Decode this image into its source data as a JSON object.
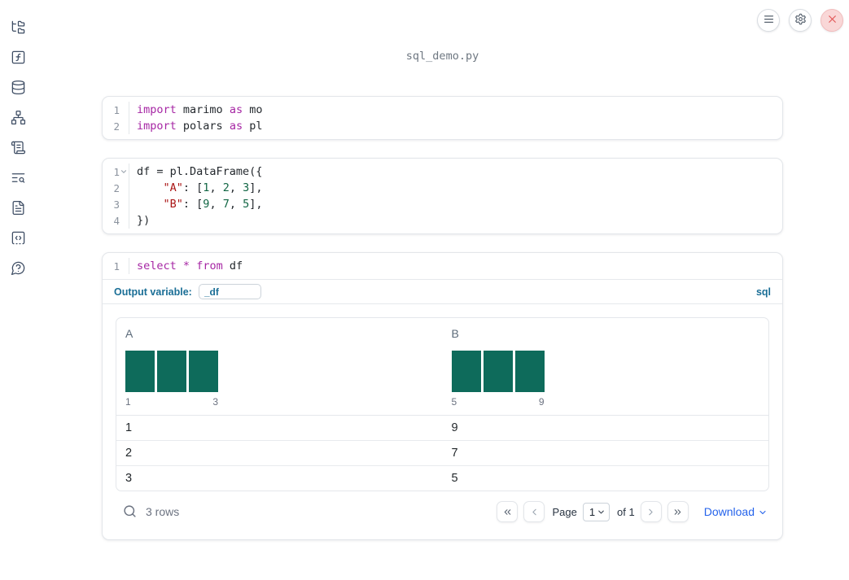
{
  "page": {
    "title": "sql_demo.py"
  },
  "sidebar": {
    "items": [
      {
        "name": "file-explorer",
        "icon": "folder-tree-icon"
      },
      {
        "name": "variables",
        "icon": "function-square-icon"
      },
      {
        "name": "data-sources",
        "icon": "database-icon"
      },
      {
        "name": "dependencies",
        "icon": "network-icon"
      },
      {
        "name": "logs",
        "icon": "scroll-text-icon"
      },
      {
        "name": "outline-search",
        "icon": "text-search-icon"
      },
      {
        "name": "documentation",
        "icon": "file-text-icon"
      },
      {
        "name": "scratchpad",
        "icon": "code-scratchpad-icon"
      },
      {
        "name": "help",
        "icon": "help-bubble-icon"
      }
    ]
  },
  "controls": [
    {
      "name": "menu",
      "icon": "menu-icon"
    },
    {
      "name": "settings",
      "icon": "gear-icon"
    },
    {
      "name": "close",
      "icon": "close-icon"
    }
  ],
  "cells": [
    {
      "type": "python",
      "line_start": 1,
      "lines": [
        [
          {
            "k": "kw",
            "t": "import"
          },
          {
            "k": "pl",
            "t": " marimo "
          },
          {
            "k": "kw",
            "t": "as"
          },
          {
            "k": "pl",
            "t": " mo"
          }
        ],
        [
          {
            "k": "kw",
            "t": "import"
          },
          {
            "k": "pl",
            "t": " polars "
          },
          {
            "k": "kw",
            "t": "as"
          },
          {
            "k": "pl",
            "t": " pl"
          }
        ]
      ]
    },
    {
      "type": "python",
      "line_start": 1,
      "fold_line": 1,
      "lines": [
        [
          {
            "k": "pl",
            "t": "df = pl.DataFrame({"
          }
        ],
        [
          {
            "k": "pl",
            "t": "    "
          },
          {
            "k": "str",
            "t": "\"A\""
          },
          {
            "k": "pl",
            "t": ": ["
          },
          {
            "k": "num",
            "t": "1"
          },
          {
            "k": "pl",
            "t": ", "
          },
          {
            "k": "num",
            "t": "2"
          },
          {
            "k": "pl",
            "t": ", "
          },
          {
            "k": "num",
            "t": "3"
          },
          {
            "k": "pl",
            "t": "],"
          }
        ],
        [
          {
            "k": "pl",
            "t": "    "
          },
          {
            "k": "str",
            "t": "\"B\""
          },
          {
            "k": "pl",
            "t": ": ["
          },
          {
            "k": "num",
            "t": "9"
          },
          {
            "k": "pl",
            "t": ", "
          },
          {
            "k": "num",
            "t": "7"
          },
          {
            "k": "pl",
            "t": ", "
          },
          {
            "k": "num",
            "t": "5"
          },
          {
            "k": "pl",
            "t": "],"
          }
        ],
        [
          {
            "k": "pl",
            "t": "})"
          }
        ]
      ]
    },
    {
      "type": "sql",
      "line_start": 1,
      "lines": [
        [
          {
            "k": "kw",
            "t": "select"
          },
          {
            "k": "pl",
            "t": " "
          },
          {
            "k": "kw",
            "t": "*"
          },
          {
            "k": "pl",
            "t": " "
          },
          {
            "k": "kw",
            "t": "from"
          },
          {
            "k": "pl",
            "t": " df"
          }
        ]
      ]
    }
  ],
  "sql_cell": {
    "output_variable_label": "Output variable:",
    "output_variable_value": "_df",
    "language_label": "sql"
  },
  "table": {
    "columns": [
      {
        "header": "A",
        "histogram": {
          "type": "bar",
          "values": [
            1,
            1,
            1
          ],
          "min_label": "1",
          "max_label": "3"
        }
      },
      {
        "header": "B",
        "histogram": {
          "type": "bar",
          "values": [
            1,
            1,
            1
          ],
          "min_label": "5",
          "max_label": "9"
        }
      }
    ],
    "rows": [
      [
        "1",
        "9"
      ],
      [
        "2",
        "7"
      ],
      [
        "3",
        "5"
      ]
    ],
    "row_count_label": "3 rows",
    "pagination": {
      "page_label": "Page",
      "page_value": "1",
      "of_label": "of 1"
    },
    "download_label": "Download"
  },
  "colors": {
    "histogram_bar": "#0e6b5b",
    "accent_blue_label": "#1a6e96",
    "download_link": "#2563eb",
    "keyword": "#a626a4",
    "string": "#aa1515",
    "number": "#116644",
    "close_button_bg": "#f9d7d7",
    "close_button_x": "#e25555"
  }
}
